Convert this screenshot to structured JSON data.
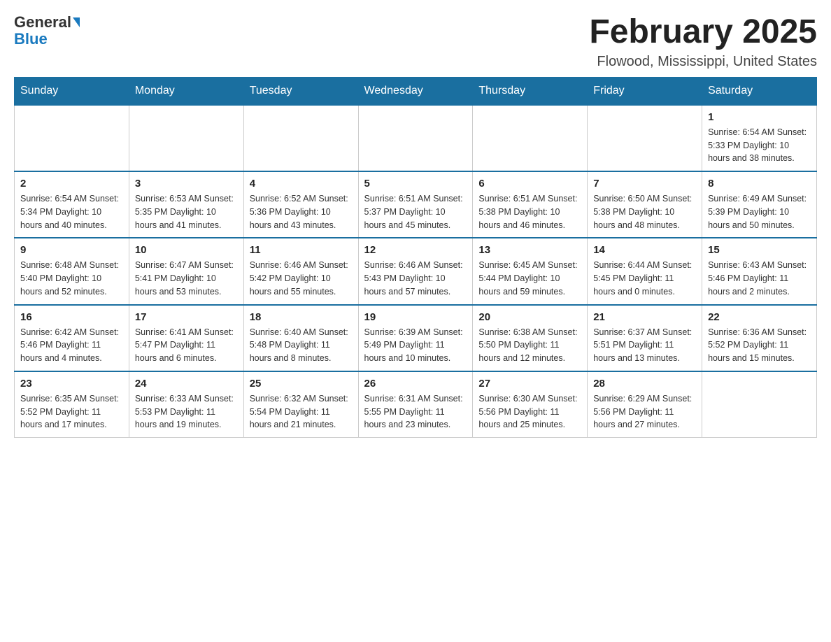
{
  "header": {
    "logo_general": "General",
    "logo_blue": "Blue",
    "month_title": "February 2025",
    "location": "Flowood, Mississippi, United States"
  },
  "weekdays": [
    "Sunday",
    "Monday",
    "Tuesday",
    "Wednesday",
    "Thursday",
    "Friday",
    "Saturday"
  ],
  "weeks": [
    [
      {
        "day": "",
        "info": ""
      },
      {
        "day": "",
        "info": ""
      },
      {
        "day": "",
        "info": ""
      },
      {
        "day": "",
        "info": ""
      },
      {
        "day": "",
        "info": ""
      },
      {
        "day": "",
        "info": ""
      },
      {
        "day": "1",
        "info": "Sunrise: 6:54 AM\nSunset: 5:33 PM\nDaylight: 10 hours\nand 38 minutes."
      }
    ],
    [
      {
        "day": "2",
        "info": "Sunrise: 6:54 AM\nSunset: 5:34 PM\nDaylight: 10 hours\nand 40 minutes."
      },
      {
        "day": "3",
        "info": "Sunrise: 6:53 AM\nSunset: 5:35 PM\nDaylight: 10 hours\nand 41 minutes."
      },
      {
        "day": "4",
        "info": "Sunrise: 6:52 AM\nSunset: 5:36 PM\nDaylight: 10 hours\nand 43 minutes."
      },
      {
        "day": "5",
        "info": "Sunrise: 6:51 AM\nSunset: 5:37 PM\nDaylight: 10 hours\nand 45 minutes."
      },
      {
        "day": "6",
        "info": "Sunrise: 6:51 AM\nSunset: 5:38 PM\nDaylight: 10 hours\nand 46 minutes."
      },
      {
        "day": "7",
        "info": "Sunrise: 6:50 AM\nSunset: 5:38 PM\nDaylight: 10 hours\nand 48 minutes."
      },
      {
        "day": "8",
        "info": "Sunrise: 6:49 AM\nSunset: 5:39 PM\nDaylight: 10 hours\nand 50 minutes."
      }
    ],
    [
      {
        "day": "9",
        "info": "Sunrise: 6:48 AM\nSunset: 5:40 PM\nDaylight: 10 hours\nand 52 minutes."
      },
      {
        "day": "10",
        "info": "Sunrise: 6:47 AM\nSunset: 5:41 PM\nDaylight: 10 hours\nand 53 minutes."
      },
      {
        "day": "11",
        "info": "Sunrise: 6:46 AM\nSunset: 5:42 PM\nDaylight: 10 hours\nand 55 minutes."
      },
      {
        "day": "12",
        "info": "Sunrise: 6:46 AM\nSunset: 5:43 PM\nDaylight: 10 hours\nand 57 minutes."
      },
      {
        "day": "13",
        "info": "Sunrise: 6:45 AM\nSunset: 5:44 PM\nDaylight: 10 hours\nand 59 minutes."
      },
      {
        "day": "14",
        "info": "Sunrise: 6:44 AM\nSunset: 5:45 PM\nDaylight: 11 hours\nand 0 minutes."
      },
      {
        "day": "15",
        "info": "Sunrise: 6:43 AM\nSunset: 5:46 PM\nDaylight: 11 hours\nand 2 minutes."
      }
    ],
    [
      {
        "day": "16",
        "info": "Sunrise: 6:42 AM\nSunset: 5:46 PM\nDaylight: 11 hours\nand 4 minutes."
      },
      {
        "day": "17",
        "info": "Sunrise: 6:41 AM\nSunset: 5:47 PM\nDaylight: 11 hours\nand 6 minutes."
      },
      {
        "day": "18",
        "info": "Sunrise: 6:40 AM\nSunset: 5:48 PM\nDaylight: 11 hours\nand 8 minutes."
      },
      {
        "day": "19",
        "info": "Sunrise: 6:39 AM\nSunset: 5:49 PM\nDaylight: 11 hours\nand 10 minutes."
      },
      {
        "day": "20",
        "info": "Sunrise: 6:38 AM\nSunset: 5:50 PM\nDaylight: 11 hours\nand 12 minutes."
      },
      {
        "day": "21",
        "info": "Sunrise: 6:37 AM\nSunset: 5:51 PM\nDaylight: 11 hours\nand 13 minutes."
      },
      {
        "day": "22",
        "info": "Sunrise: 6:36 AM\nSunset: 5:52 PM\nDaylight: 11 hours\nand 15 minutes."
      }
    ],
    [
      {
        "day": "23",
        "info": "Sunrise: 6:35 AM\nSunset: 5:52 PM\nDaylight: 11 hours\nand 17 minutes."
      },
      {
        "day": "24",
        "info": "Sunrise: 6:33 AM\nSunset: 5:53 PM\nDaylight: 11 hours\nand 19 minutes."
      },
      {
        "day": "25",
        "info": "Sunrise: 6:32 AM\nSunset: 5:54 PM\nDaylight: 11 hours\nand 21 minutes."
      },
      {
        "day": "26",
        "info": "Sunrise: 6:31 AM\nSunset: 5:55 PM\nDaylight: 11 hours\nand 23 minutes."
      },
      {
        "day": "27",
        "info": "Sunrise: 6:30 AM\nSunset: 5:56 PM\nDaylight: 11 hours\nand 25 minutes."
      },
      {
        "day": "28",
        "info": "Sunrise: 6:29 AM\nSunset: 5:56 PM\nDaylight: 11 hours\nand 27 minutes."
      },
      {
        "day": "",
        "info": ""
      }
    ]
  ]
}
